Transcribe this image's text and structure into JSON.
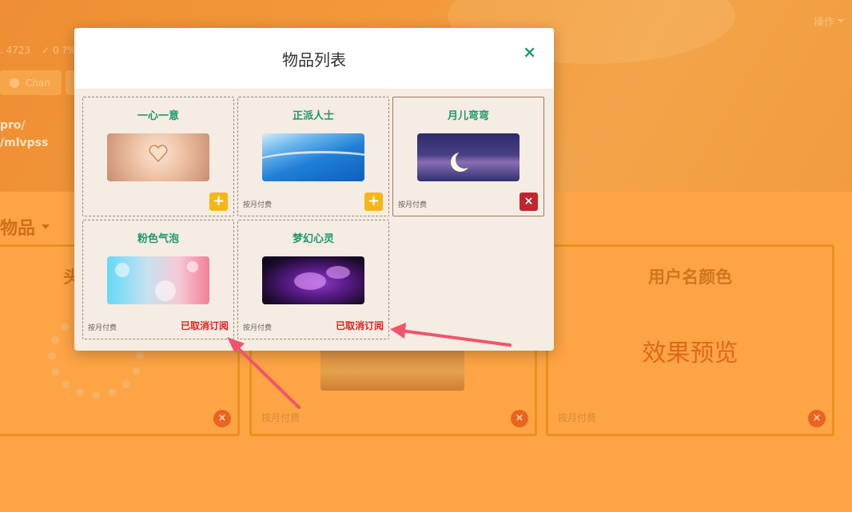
{
  "background": {
    "ops_label": "操作",
    "stats": [
      ". 4723",
      "✓ 0 ?%"
    ],
    "chan_label": "Chan",
    "path_lines": [
      "pro/",
      "/mlvpss"
    ],
    "items_heading": "物品",
    "cards": [
      {
        "title": "头",
        "label": ""
      },
      {
        "title": "",
        "label": "按月付费"
      },
      {
        "title": "用户名颜色",
        "preview": "效果预览",
        "label": "按月付费"
      }
    ],
    "close_glyph": "×"
  },
  "modal": {
    "title": "物品列表",
    "close_glyph": "×",
    "items": [
      {
        "name": "一心一意",
        "billing": "",
        "action": "add",
        "action_glyph": "+",
        "status": ""
      },
      {
        "name": "正派人士",
        "billing": "按月付费",
        "action": "add",
        "action_glyph": "+",
        "status": ""
      },
      {
        "name": "月儿弯弯",
        "billing": "按月付费",
        "action": "remove",
        "action_glyph": "×",
        "status": ""
      },
      {
        "name": "粉色气泡",
        "billing": "按月付费",
        "action": "none",
        "action_glyph": "",
        "status": "已取消订阅"
      },
      {
        "name": "梦幻心灵",
        "billing": "按月付费",
        "action": "none",
        "action_glyph": "",
        "status": "已取消订阅"
      }
    ]
  },
  "colors": {
    "accent_green": "#1b9a6c",
    "add_yellow": "#f6b617",
    "remove_red": "#c0262f",
    "cancelled_red": "#e0211f",
    "arrow_pink": "#f0546b"
  }
}
